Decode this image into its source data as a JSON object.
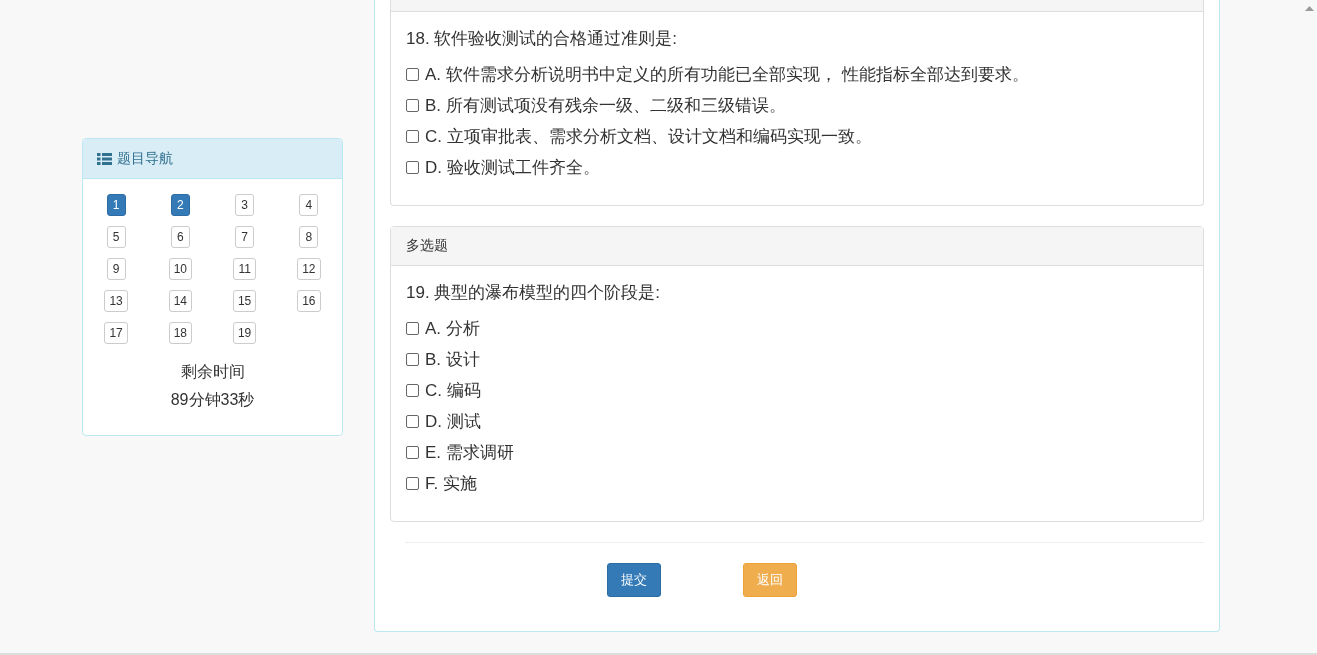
{
  "nav_panel": {
    "title": "题目导航",
    "questions": [
      {
        "label": "1",
        "answered": true
      },
      {
        "label": "2",
        "answered": true
      },
      {
        "label": "3",
        "answered": false
      },
      {
        "label": "4",
        "answered": false
      },
      {
        "label": "5",
        "answered": false
      },
      {
        "label": "6",
        "answered": false
      },
      {
        "label": "7",
        "answered": false
      },
      {
        "label": "8",
        "answered": false
      },
      {
        "label": "9",
        "answered": false
      },
      {
        "label": "10",
        "answered": false
      },
      {
        "label": "11",
        "answered": false
      },
      {
        "label": "12",
        "answered": false
      },
      {
        "label": "13",
        "answered": false
      },
      {
        "label": "14",
        "answered": false
      },
      {
        "label": "15",
        "answered": false
      },
      {
        "label": "16",
        "answered": false
      },
      {
        "label": "17",
        "answered": false
      },
      {
        "label": "18",
        "answered": false
      },
      {
        "label": "19",
        "answered": false
      }
    ],
    "time_label": "剩余时间",
    "time_value": "89分钟33秒"
  },
  "questions": [
    {
      "text": "18. 软件验收测试的合格通过准则是:",
      "options": [
        {
          "label": "A. 软件需求分析说明书中定义的所有功能已全部实现， 性能指标全部达到要求。",
          "checked": false
        },
        {
          "label": "B. 所有测试项没有残余一级、二级和三级错误。",
          "checked": false
        },
        {
          "label": "C. 立项审批表、需求分析文档、设计文档和编码实现一致。",
          "checked": false
        },
        {
          "label": "D. 验收测试工件齐全。",
          "checked": false
        }
      ]
    },
    {
      "section": "多选题",
      "text": "19. 典型的瀑布模型的四个阶段是:",
      "options": [
        {
          "label": "A. 分析",
          "checked": false
        },
        {
          "label": "B. 设计",
          "checked": false
        },
        {
          "label": "C. 编码",
          "checked": false
        },
        {
          "label": "D. 测试",
          "checked": false
        },
        {
          "label": "E. 需求调研",
          "checked": false
        },
        {
          "label": "F. 实施",
          "checked": false
        }
      ]
    }
  ],
  "buttons": [
    {
      "label": "提交",
      "kind": "primary"
    },
    {
      "label": "返回",
      "kind": "warning"
    }
  ]
}
